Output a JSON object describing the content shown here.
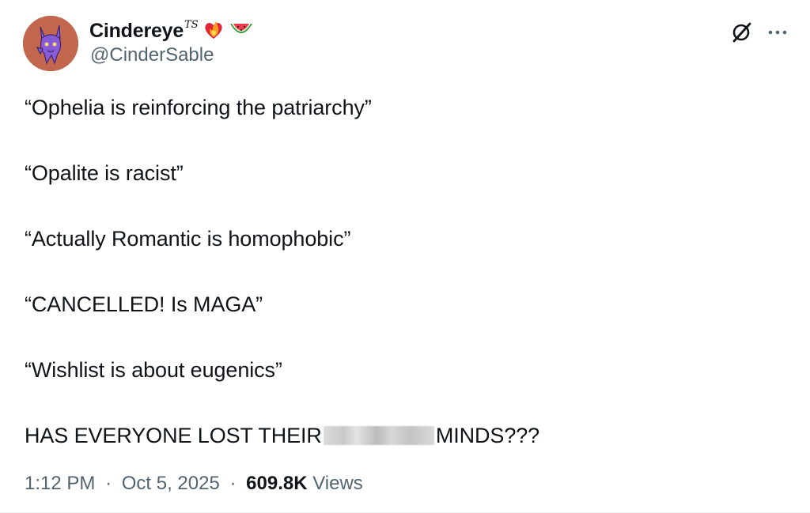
{
  "author": {
    "display_name": "Cindereye",
    "name_suffix": "TS",
    "name_emojis": [
      "fire-heart-emoji",
      "watermelon-emoji"
    ],
    "handle": "@CinderSable",
    "avatar": "purple-creature-avatar"
  },
  "actions": {
    "grok_icon": "grok-icon",
    "more_icon": "more-options-icon"
  },
  "tweet": {
    "lines": [
      "“Ophelia is reinforcing the patriarchy”",
      "“Opalite is racist”",
      "“Actually Romantic is homophobic”",
      "“CANCELLED! Is MAGA”",
      "“Wishlist is about eugenics”"
    ],
    "last_line_start": "HAS EVERYONE LOST THEIR",
    "last_line_end": "MINDS???"
  },
  "meta": {
    "time": "1:12 PM",
    "date": "Oct 5, 2025",
    "separator": "·",
    "views_count": "609.8K",
    "views_label": "Views"
  },
  "colors": {
    "text": "#0f1419",
    "secondary": "#536471",
    "background": "#ffffff"
  }
}
